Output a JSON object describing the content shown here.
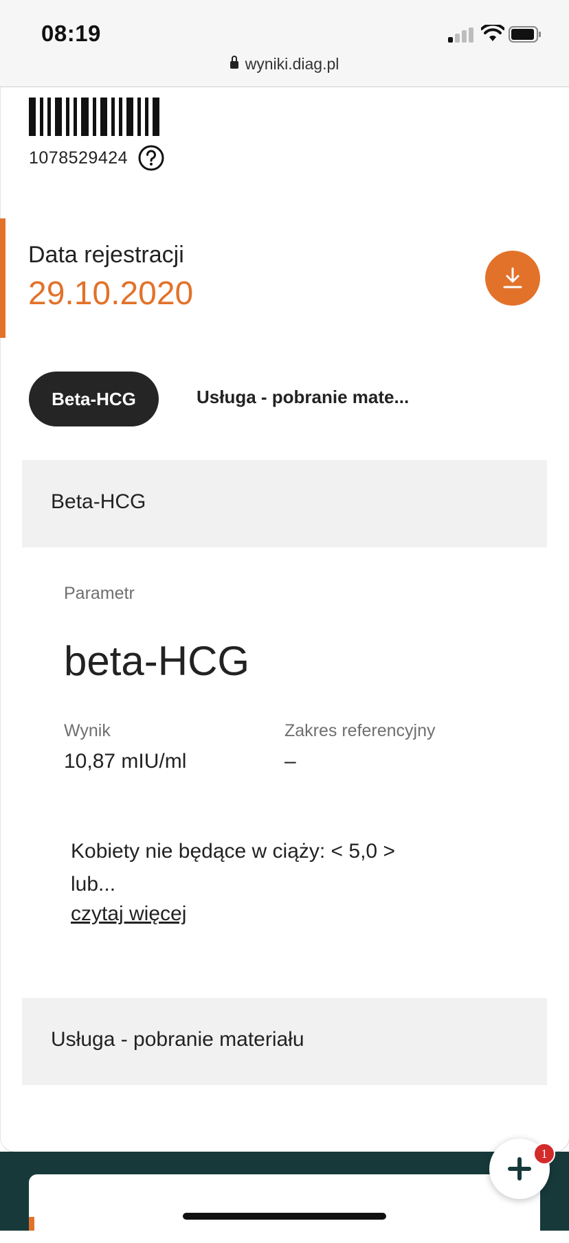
{
  "status_bar": {
    "time": "08:19"
  },
  "browser": {
    "url": "wyniki.diag.pl"
  },
  "order": {
    "barcode_number": "1078529424",
    "registration_label": "Data rejestracji",
    "registration_date": "29.10.2020"
  },
  "tabs": [
    {
      "label": "Beta-HCG",
      "active": true
    },
    {
      "label": "Usługa - pobranie mate...",
      "active": false
    }
  ],
  "sections": [
    {
      "title": "Beta-HCG",
      "parameter_label": "Parametr",
      "parameter_name": "beta-HCG",
      "result_label": "Wynik",
      "result_value": "10,87 mIU/ml",
      "reference_label": "Zakres referencyjny",
      "reference_value": "–",
      "note": "Kobiety nie będące w ciąży: < 5,0 > lub...",
      "read_more": "czytaj więcej"
    },
    {
      "title": "Usługa - pobranie materiału"
    }
  ],
  "chat": {
    "badge_count": "1"
  },
  "colors": {
    "accent": "#e2722a",
    "dark": "#17393a",
    "tab_active_bg": "#252525",
    "badge": "#d32a2a"
  },
  "icons": [
    "lock-icon",
    "help-icon",
    "download-icon",
    "plus-icon",
    "signal-icon",
    "wifi-icon",
    "battery-icon"
  ]
}
